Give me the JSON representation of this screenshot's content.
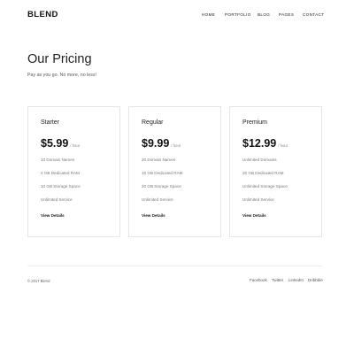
{
  "brand": {
    "logo": "BLEND"
  },
  "nav": {
    "items": [
      {
        "label": "HOME"
      },
      {
        "label": "PORTFOLIO"
      },
      {
        "label": "BLOG"
      },
      {
        "label": "PAGES"
      },
      {
        "label": "CONTACT"
      }
    ]
  },
  "hero": {
    "title": "Our Pricing",
    "subtitle": "Pay as you go. No more, no less!"
  },
  "plans": [
    {
      "name": "Starter",
      "price": "$5.99",
      "period": "/ hour",
      "features": [
        "10 Domain Names",
        "2 GB Dedicated RAM",
        "10 GB Storage Space",
        "Unlimited Service"
      ],
      "cta": "View Details"
    },
    {
      "name": "Regular",
      "price": "$9.99",
      "period": "/ hour",
      "features": [
        "20 Domain Names",
        "10 GB Dedicated RAM",
        "20 GB Storage Space",
        "Unlimited Service"
      ],
      "cta": "View Details"
    },
    {
      "name": "Premium",
      "price": "$12.99",
      "period": "/ hour",
      "features": [
        "Unlimited Domains",
        "20 GB Dedicated RAM",
        "Unlimited Storage Space",
        "Unlimited Service"
      ],
      "cta": "View Details"
    }
  ],
  "footer": {
    "copyright": "© 2017 Blend",
    "social": [
      {
        "label": "Facebook"
      },
      {
        "label": "Twitter"
      },
      {
        "label": "LinkedIn"
      },
      {
        "label": "Dribbble"
      }
    ]
  }
}
